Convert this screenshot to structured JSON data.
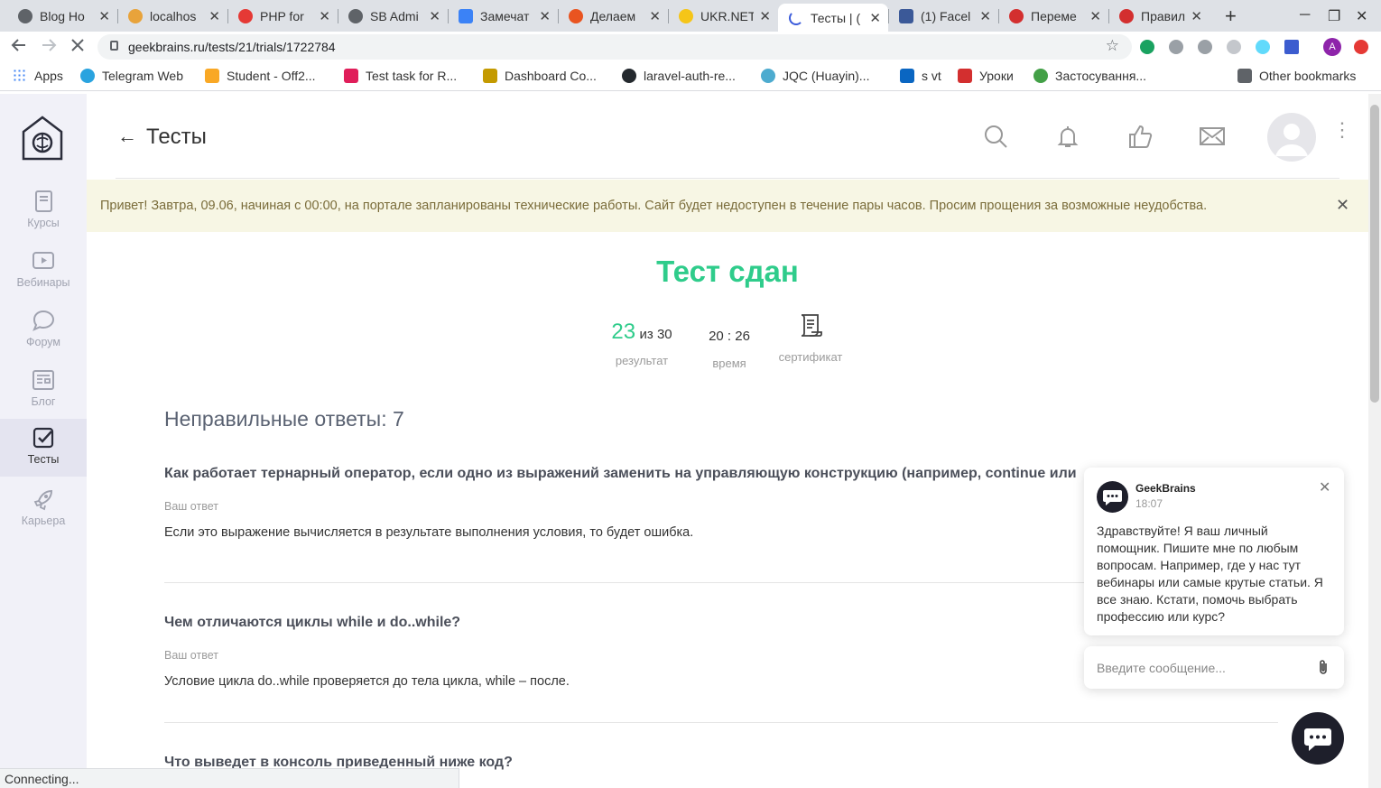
{
  "browser": {
    "tabs": [
      {
        "label": "Blog Ho",
        "color": "#5f6368"
      },
      {
        "label": "localhos",
        "color": "#e8a33b"
      },
      {
        "label": "PHP for",
        "color": "#e53935"
      },
      {
        "label": "SB Admi",
        "color": "#5f6368"
      },
      {
        "label": "Замечат",
        "color": "#3b82f6"
      },
      {
        "label": "Делаем",
        "color": "#e95420"
      },
      {
        "label": "UKR.NET",
        "color": "#f5c518"
      },
      {
        "label": "Тесты | (",
        "color": "#3b5bdb"
      },
      {
        "label": "(1) Facel",
        "color": "#3b5998"
      },
      {
        "label": "Переме",
        "color": "#d32f2f"
      },
      {
        "label": "Правил",
        "color": "#d32f2f"
      }
    ],
    "tab_close": "✕",
    "new_tab": "+",
    "window_controls": [
      "─",
      "❐",
      "✕"
    ],
    "url": "geekbrains.ru/tests/21/trials/1722784",
    "profile_initial": "A",
    "bookmarks": [
      {
        "label": "Apps",
        "color": "#4285f4"
      },
      {
        "label": "Telegram Web",
        "color": "#2aa3df"
      },
      {
        "label": "Student - Off2...",
        "color": "#f9a825"
      },
      {
        "label": "Test task for R...",
        "color": "#e01e5a"
      },
      {
        "label": "Dashboard Co...",
        "color": "#c49a00"
      },
      {
        "label": "laravel-auth-re...",
        "color": "#24292e"
      },
      {
        "label": "JQC (Huayin)...",
        "color": "#4dabcf"
      },
      {
        "label": "s vt",
        "color": "#0a66c2"
      },
      {
        "label": "Уроки",
        "color": "#d32f2f"
      },
      {
        "label": "Застосування...",
        "color": "#43a047"
      }
    ],
    "other_bookmarks": "Other bookmarks",
    "status": "Connecting..."
  },
  "sidenav": {
    "items": [
      {
        "label": "Курсы",
        "icon": "book-icon"
      },
      {
        "label": "Вебинары",
        "icon": "video-icon"
      },
      {
        "label": "Форум",
        "icon": "chat-bubble-icon"
      },
      {
        "label": "Блог",
        "icon": "newspaper-icon"
      },
      {
        "label": "Тесты",
        "icon": "checkbox-icon",
        "active": true
      },
      {
        "label": "Карьера",
        "icon": "rocket-icon"
      }
    ]
  },
  "header": {
    "back_arrow": "←",
    "title": "Тесты",
    "kebab": "⋮"
  },
  "banner": {
    "text": "Привет! Завтра, 09.06, начиная с 00:00, на портале запланированы технические работы. Сайт будет недоступен в течение пары часов. Просим прощения за возможные неудобства.",
    "close": "✕"
  },
  "result": {
    "title": "Тест сдан",
    "score": "23",
    "score_total": "из 30",
    "score_label": "результат",
    "time": "20 : 26",
    "time_label": "время",
    "certificate_label": "сертификат"
  },
  "wrong": {
    "heading": "Неправильные ответы: 7",
    "your_answer_label": "Ваш ответ",
    "questions": [
      {
        "q": "Как работает тернарный оператор, если одно из выражений заменить на управляющую конструкцию (например, continue или",
        "a": "Если это выражение вычисляется в результате выполнения условия, то будет ошибка."
      },
      {
        "q": "Чем отличаются циклы while и do..while?",
        "a": "Условие цикла do..while проверяется до тела цикла, while – после."
      },
      {
        "q": "Что выведет в консоль приведенный ниже код?",
        "a": ""
      }
    ]
  },
  "chat": {
    "name": "GeekBrains",
    "time": "18:07",
    "close": "✕",
    "message": "Здравствуйте! Я ваш личный помощник. Пишите мне по любым вопросам. Например, где у нас тут вебинары или самые крутые статьи. Я все знаю. Кстати, помочь выбрать профессию или курс?",
    "placeholder": "Введите сообщение..."
  }
}
